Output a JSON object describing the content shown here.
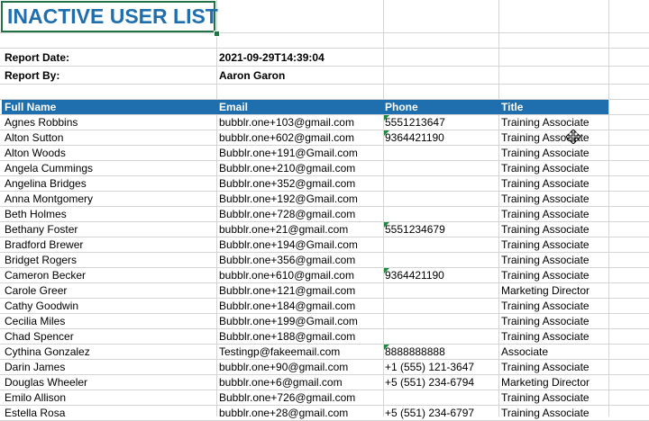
{
  "title": "INACTIVE USER LIST",
  "report": {
    "date_label": "Report Date:",
    "date_value": "2021-09-29T14:39:04",
    "by_label": "Report By:",
    "by_value": "Aaron Garon"
  },
  "columns": {
    "name": "Full Name",
    "email": "Email",
    "phone": "Phone",
    "title": "Title"
  },
  "colors": {
    "header_bg": "#1f6fae",
    "title_text": "#1f6fae",
    "selection": "#217346",
    "comment_flag": "#1e8a3c"
  },
  "icons": [
    "move-cursor-icon",
    "comment-flag-icon"
  ],
  "rows": [
    {
      "name": "Agnes Robbins",
      "email": "bubblr.one+103@gmail.com",
      "phone": "5551213647",
      "title": "Training Associate",
      "flag": true
    },
    {
      "name": "Alton Sutton",
      "email": "bubblr.one+602@gmail.com",
      "phone": "9364421190",
      "title": "Training Associate",
      "flag": true
    },
    {
      "name": "Alton Woods",
      "email": "Bubblr.one+191@Gmail.com",
      "phone": "",
      "title": "Training Associate",
      "flag": false
    },
    {
      "name": "Angela Cummings",
      "email": "Bubblr.one+210@gmail.com",
      "phone": "",
      "title": "Training Associate",
      "flag": false
    },
    {
      "name": "Angelina Bridges",
      "email": "Bubblr.one+352@gmail.com",
      "phone": "",
      "title": "Training Associate",
      "flag": false
    },
    {
      "name": "Anna Montgomery",
      "email": "Bubblr.one+192@Gmail.com",
      "phone": "",
      "title": "Training Associate",
      "flag": false
    },
    {
      "name": "Beth Holmes",
      "email": "Bubblr.one+728@gmail.com",
      "phone": "",
      "title": "Training Associate",
      "flag": false
    },
    {
      "name": "Bethany Foster",
      "email": "bubblr.one+21@gmail.com",
      "phone": "5551234679",
      "title": "Training Associate",
      "flag": true
    },
    {
      "name": "Bradford Brewer",
      "email": "Bubblr.one+194@Gmail.com",
      "phone": "",
      "title": "Training Associate",
      "flag": false
    },
    {
      "name": "Bridget Rogers",
      "email": "Bubblr.one+356@gmail.com",
      "phone": "",
      "title": "Training Associate",
      "flag": false
    },
    {
      "name": "Cameron Becker",
      "email": "bubblr.one+610@gmail.com",
      "phone": "9364421190",
      "title": "Training Associate",
      "flag": true
    },
    {
      "name": "Carole Greer",
      "email": "Bubblr.one+121@gmail.com",
      "phone": "",
      "title": "Marketing Director",
      "flag": false
    },
    {
      "name": "Cathy Goodwin",
      "email": "Bubblr.one+184@gmail.com",
      "phone": "",
      "title": "Training Associate",
      "flag": false
    },
    {
      "name": "Cecilia Miles",
      "email": "Bubblr.one+199@Gmail.com",
      "phone": "",
      "title": "Training Associate",
      "flag": false
    },
    {
      "name": "Chad Spencer",
      "email": "Bubblr.one+188@gmail.com",
      "phone": "",
      "title": "Training Associate",
      "flag": false
    },
    {
      "name": "Cythina Gonzalez",
      "email": "Testingp@fakeemail.com",
      "phone": "8888888888",
      "title": "Associate",
      "flag": true
    },
    {
      "name": "Darin James",
      "email": "bubblr.one+90@gmail.com",
      "phone": "+1 (555) 121-3647",
      "title": "Training Associate",
      "flag": false
    },
    {
      "name": "Douglas Wheeler",
      "email": "bubblr.one+6@gmail.com",
      "phone": "+5 (551) 234-6794",
      "title": "Marketing Director",
      "flag": false
    },
    {
      "name": "Emilo Allison",
      "email": "Bubblr.one+726@gmail.com",
      "phone": "",
      "title": "Training Associate",
      "flag": false
    },
    {
      "name": "Estella Rosa",
      "email": "bubblr.one+28@gmail.com",
      "phone": "+5 (551) 234-6797",
      "title": "Training Associate",
      "flag": false
    }
  ]
}
